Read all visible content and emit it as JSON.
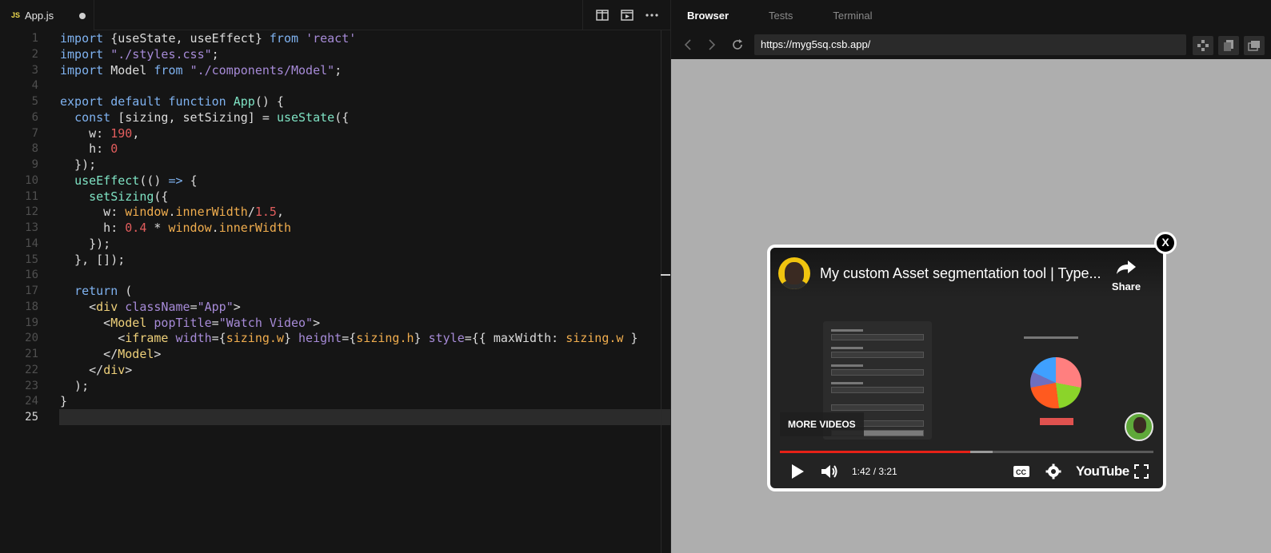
{
  "editor": {
    "tab": {
      "badge": "JS",
      "filename": "App.js"
    },
    "actions": [
      "split-view-icon",
      "preview-icon",
      "more-icon"
    ],
    "lines": [
      {
        "num": "1"
      },
      {
        "num": "2"
      },
      {
        "num": "3"
      },
      {
        "num": "4"
      },
      {
        "num": "5"
      },
      {
        "num": "6"
      },
      {
        "num": "7"
      },
      {
        "num": "8"
      },
      {
        "num": "9"
      },
      {
        "num": "10"
      },
      {
        "num": "11"
      },
      {
        "num": "12"
      },
      {
        "num": "13"
      },
      {
        "num": "14"
      },
      {
        "num": "15"
      },
      {
        "num": "16"
      },
      {
        "num": "17"
      },
      {
        "num": "18"
      },
      {
        "num": "19"
      },
      {
        "num": "20"
      },
      {
        "num": "21"
      },
      {
        "num": "22"
      },
      {
        "num": "23"
      },
      {
        "num": "24"
      },
      {
        "num": "25"
      }
    ],
    "code": [
      [
        [
          "k",
          "import "
        ],
        [
          "p",
          "{useState, useEffect} "
        ],
        [
          "k",
          "from "
        ],
        [
          "s",
          "'react'"
        ]
      ],
      [
        [
          "k",
          "import "
        ],
        [
          "s",
          "\"./styles.css\""
        ],
        [
          "p",
          ";"
        ]
      ],
      [
        [
          "k",
          "import "
        ],
        [
          "p",
          "Model "
        ],
        [
          "k",
          "from "
        ],
        [
          "s",
          "\"./components/Model\""
        ],
        [
          "p",
          ";"
        ]
      ],
      [],
      [
        [
          "k",
          "export default function "
        ],
        [
          "f",
          "App"
        ],
        [
          "p",
          "() {"
        ]
      ],
      [
        [
          "p",
          "  "
        ],
        [
          "k",
          "const "
        ],
        [
          "p",
          "[sizing, setSizing] = "
        ],
        [
          "f",
          "useState"
        ],
        [
          "p",
          "({"
        ]
      ],
      [
        [
          "p",
          "    w: "
        ],
        [
          "n",
          "190"
        ],
        [
          "p",
          ","
        ]
      ],
      [
        [
          "p",
          "    h: "
        ],
        [
          "n",
          "0"
        ]
      ],
      [
        [
          "p",
          "  });"
        ]
      ],
      [
        [
          "p",
          "  "
        ],
        [
          "f",
          "useEffect"
        ],
        [
          "p",
          "(() "
        ],
        [
          "k",
          "=> "
        ],
        [
          "p",
          "{"
        ]
      ],
      [
        [
          "p",
          "    "
        ],
        [
          "f",
          "setSizing"
        ],
        [
          "p",
          "({"
        ]
      ],
      [
        [
          "p",
          "      w: "
        ],
        [
          "v",
          "window"
        ],
        [
          "p",
          "."
        ],
        [
          "v",
          "innerWidth"
        ],
        [
          "p",
          "/"
        ],
        [
          "n",
          "1.5"
        ],
        [
          "p",
          ","
        ]
      ],
      [
        [
          "p",
          "      h: "
        ],
        [
          "n",
          "0.4"
        ],
        [
          "p",
          " * "
        ],
        [
          "v",
          "window"
        ],
        [
          "p",
          "."
        ],
        [
          "v",
          "innerWidth"
        ]
      ],
      [
        [
          "p",
          "    });"
        ]
      ],
      [
        [
          "p",
          "  }, []);"
        ]
      ],
      [],
      [
        [
          "p",
          "  "
        ],
        [
          "k",
          "return "
        ],
        [
          "p",
          "("
        ]
      ],
      [
        [
          "p",
          "    <"
        ],
        [
          "t",
          "div "
        ],
        [
          "a",
          "className"
        ],
        [
          "p",
          "="
        ],
        [
          "s",
          "\"App\""
        ],
        [
          "p",
          ">"
        ]
      ],
      [
        [
          "p",
          "      <"
        ],
        [
          "t",
          "Model "
        ],
        [
          "a",
          "popTitle"
        ],
        [
          "p",
          "="
        ],
        [
          "s",
          "\"Watch Video\""
        ],
        [
          "p",
          ">"
        ]
      ],
      [
        [
          "p",
          "        <"
        ],
        [
          "t",
          "iframe "
        ],
        [
          "a",
          "width"
        ],
        [
          "p",
          "={"
        ],
        [
          "v",
          "sizing.w"
        ],
        [
          "p",
          "} "
        ],
        [
          "a",
          "height"
        ],
        [
          "p",
          "={"
        ],
        [
          "v",
          "sizing.h"
        ],
        [
          "p",
          "} "
        ],
        [
          "a",
          "style"
        ],
        [
          "p",
          "={{ maxWidth: "
        ],
        [
          "v",
          "sizing.w"
        ],
        [
          "p",
          " }"
        ]
      ],
      [
        [
          "p",
          "      </"
        ],
        [
          "t",
          "Model"
        ],
        [
          "p",
          ">"
        ]
      ],
      [
        [
          "p",
          "    </"
        ],
        [
          "t",
          "div"
        ],
        [
          "p",
          ">"
        ]
      ],
      [
        [
          "p",
          "  );"
        ]
      ],
      [
        [
          "p",
          "}"
        ]
      ],
      []
    ]
  },
  "browser": {
    "tabs": [
      "Browser",
      "Tests",
      "Terminal"
    ],
    "url": "https://myg5sq.csb.app/",
    "video": {
      "title": "My custom Asset segmentation tool | Type...",
      "share_label": "Share",
      "more_videos": "MORE VIDEOS",
      "time": "1:42 / 3:21",
      "logo": "YouTube",
      "played_fraction": 0.51,
      "buffered_fraction": 0.57
    },
    "close_label": "X"
  }
}
